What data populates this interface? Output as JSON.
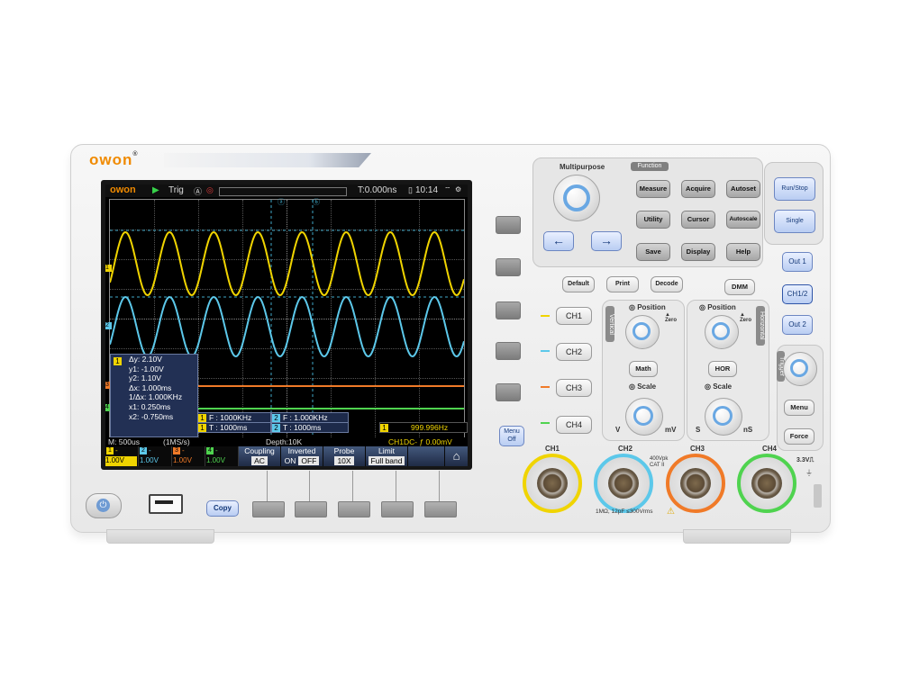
{
  "brand": {
    "name": "owon"
  },
  "screen": {
    "topbar": {
      "logo": "owon",
      "run_icon": "play-icon",
      "trig": "Trig",
      "time_offset": "T:0.000ns",
      "clock": "10:14"
    },
    "measurements": {
      "delta_y": "Δy: 2.10V",
      "y1": "y1: -1.00V",
      "y2": "y2: 1.10V",
      "delta_x": "Δx: 1.000ms",
      "inv_delta_x": "1/Δx: 1.000KHz",
      "x1": "x1: 0.250ms",
      "x2": "x2: -0.750ms"
    },
    "freq_boxes": [
      {
        "ch": "1",
        "text": "F : 1000KHz"
      },
      {
        "ch": "2",
        "text": "F : 1.000KHz"
      },
      {
        "ch": "1",
        "text": "T : 1000ms"
      },
      {
        "ch": "2",
        "text": "T : 1000ms"
      }
    ],
    "counter": {
      "ch": "1",
      "value": "999.996Hz"
    },
    "status": {
      "timebase": "M: 500us",
      "sample_rate": "(1MS/s)",
      "depth": "Depth:10K",
      "trigger": "CH1DC- ƒ 0.00mV"
    },
    "channels": [
      {
        "num": "1",
        "sym": "-",
        "scale": "1.00V",
        "color": "#f0d400"
      },
      {
        "num": "2",
        "sym": "-",
        "scale": "1.00V",
        "color": "#5cc8ea"
      },
      {
        "num": "3",
        "sym": "-",
        "scale": "1.00V",
        "color": "#f07a28"
      },
      {
        "num": "4",
        "sym": "-",
        "scale": "1.00V",
        "color": "#4fd34f"
      }
    ],
    "menu": [
      {
        "label": "Coupling",
        "value": "AC"
      },
      {
        "label": "Inverted",
        "value_on": "ON",
        "value_off": "OFF"
      },
      {
        "label": "Probe",
        "value": "10X"
      },
      {
        "label": "Limit",
        "value": "Full band"
      }
    ],
    "home_icon": "home-icon",
    "markers": {
      "ch1": "1",
      "ch2": "2",
      "ch3": "3",
      "ch4": "4"
    }
  },
  "panel": {
    "multipurpose": "Multipurpose",
    "function_tab": "Function",
    "function_buttons": [
      "Measure",
      "Acquire",
      "Autoset",
      "Utility",
      "Cursor",
      "Autoscale",
      "Save",
      "Display",
      "Help"
    ],
    "run_stop": "Run/Stop",
    "single": "Single",
    "default": "Default",
    "print": "Print",
    "decode": "Decode",
    "dmm": "DMM",
    "out1": "Out 1",
    "out12": "CH1/2",
    "out2": "Out 2",
    "ch_buttons": [
      "CH1",
      "CH2",
      "CH3",
      "CH4"
    ],
    "menu_off": "Menu Off",
    "vertical_tab": "Vertical",
    "horizontal_tab": "Horizontal",
    "trigger_tab": "Trigger",
    "position": "Position",
    "scale": "Scale",
    "math": "Math",
    "hor": "HOR",
    "zero": "Zero",
    "v": "V",
    "mv": "mV",
    "s": "S",
    "ns": "nS",
    "menu": "Menu",
    "force": "Force",
    "copy": "Copy",
    "bnc_labels": [
      "CH1",
      "CH2",
      "CH3",
      "CH4"
    ],
    "rating": "400Vpk CAT II",
    "input_spec": "1MΩ, 12pF ≤300Vrms",
    "cal_out": "3.3V⎍"
  }
}
